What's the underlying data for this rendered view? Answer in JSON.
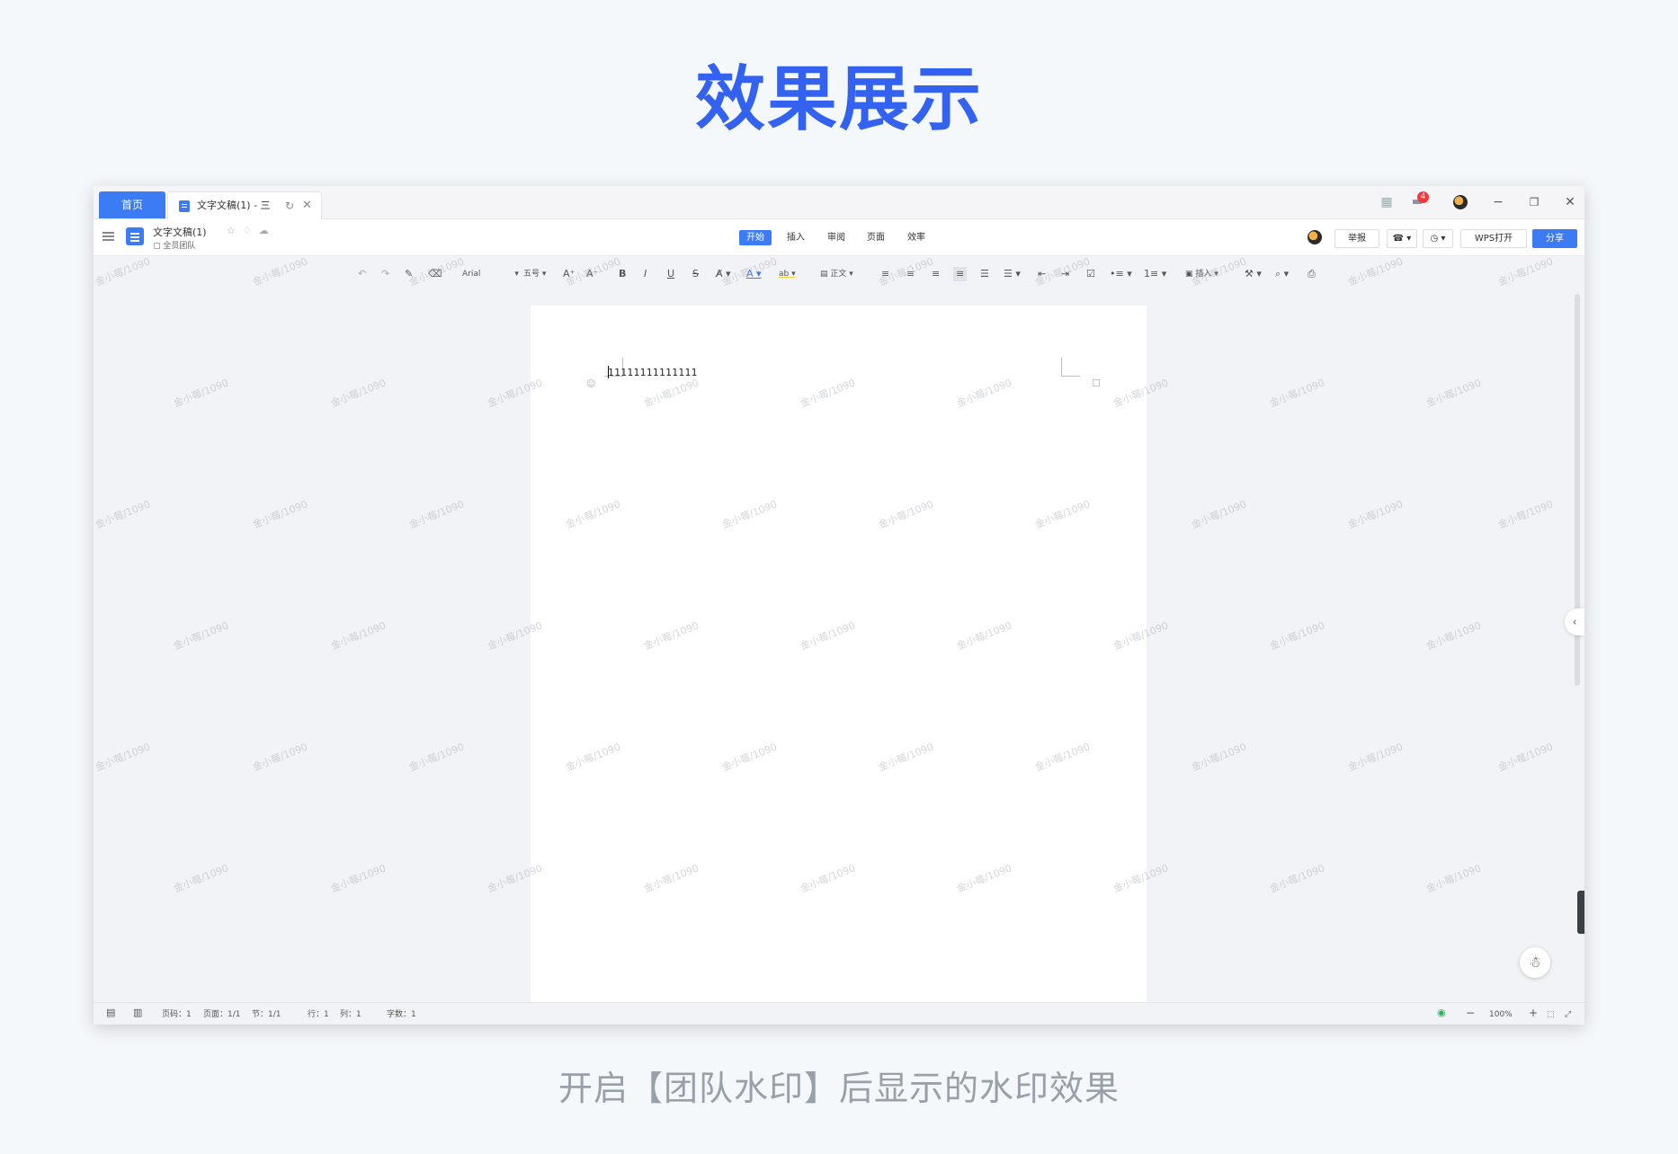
{
  "hero": {
    "title": "效果展示",
    "caption": "开启【团队水印】后显示的水印效果"
  },
  "tabs": {
    "home": "首页",
    "doc": "文字文稿(1) - 三",
    "notif_count": "4"
  },
  "titlebar": {
    "doc_name": "文字文稿(1)",
    "team": "全员团队",
    "menus": [
      "开始",
      "插入",
      "审阅",
      "页面",
      "效率"
    ],
    "report": "举报",
    "open_wps": "WPS打开",
    "share": "分享"
  },
  "toolbar": {
    "font": "Arial",
    "size": "五号",
    "style": "正文",
    "insert": "插入"
  },
  "document": {
    "text": "11111111111111"
  },
  "watermark": {
    "text": "金小莓/1090"
  },
  "status": {
    "page_no": "页码：1",
    "pages": "页面：1/1",
    "section": "节：1/1",
    "row": "行：1",
    "col": "列：1",
    "words": "字数：1",
    "zoom": "100%"
  },
  "icons": [
    "menu-icon",
    "doc-icon",
    "star-icon",
    "tag-icon",
    "cloud-icon",
    "reload-icon",
    "close-icon",
    "apps-icon",
    "chat-icon",
    "minimize-icon",
    "restore-icon",
    "window-close-icon",
    "undo-icon",
    "redo-icon",
    "format-painter-icon",
    "eraser-icon",
    "bold-icon",
    "italic-icon",
    "underline-icon",
    "strikethrough-icon",
    "font-color-icon",
    "highlight-icon",
    "align-left-icon",
    "align-center-icon",
    "align-right-icon",
    "justify-icon",
    "bullet-list-icon",
    "numbered-list-icon",
    "search-icon",
    "print-icon",
    "comment-icon",
    "emoji-icon",
    "assistant-icon",
    "collapse-icon",
    "zoom-in-icon",
    "zoom-out-icon",
    "fit-icon",
    "fullscreen-icon"
  ]
}
